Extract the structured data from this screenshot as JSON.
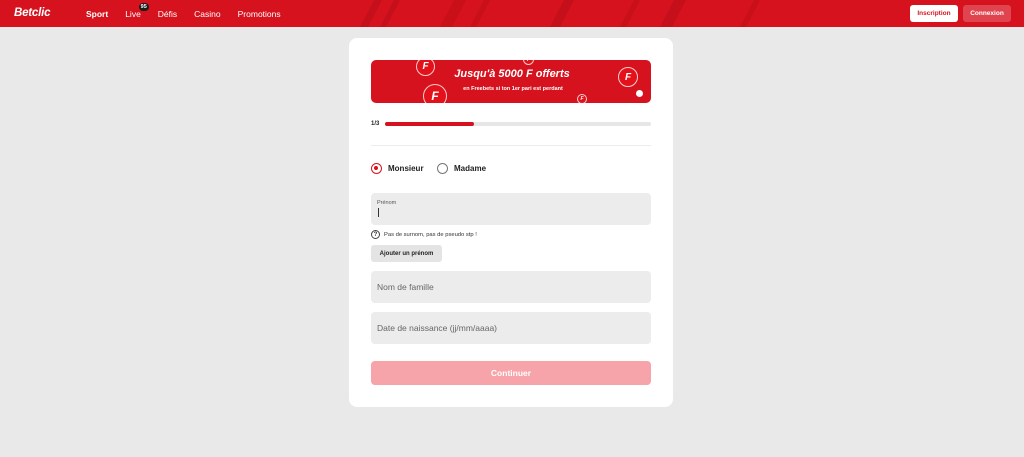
{
  "header": {
    "logo": "Betclic",
    "nav": [
      {
        "label": "Sport",
        "active": true
      },
      {
        "label": "Live",
        "badge": "95"
      },
      {
        "label": "Défis"
      },
      {
        "label": "Casino"
      },
      {
        "label": "Promotions"
      }
    ],
    "signup_label": "Inscription",
    "login_label": "Connexion",
    "accent_color": "#d5121e"
  },
  "banner": {
    "title": "Jusqu'à 5000 F offerts",
    "subtitle": "en Freebets si ton 1er pari est perdant",
    "coin_glyph": "F"
  },
  "progress": {
    "step_label": "1/3",
    "fraction": 0.333
  },
  "civility": {
    "options": [
      {
        "label": "Monsieur",
        "selected": true
      },
      {
        "label": "Madame",
        "selected": false
      }
    ]
  },
  "form": {
    "first_name_label": "Prénom",
    "first_name_value": "",
    "hint_icon": "question-circle-icon",
    "hint_text": "Pas de surnom, pas de pseudo stp !",
    "add_first_name_label": "Ajouter un prénom",
    "last_name_placeholder": "Nom de famille",
    "birthdate_placeholder": "Date de naissance (jj/mm/aaaa)",
    "continue_label": "Continuer"
  }
}
